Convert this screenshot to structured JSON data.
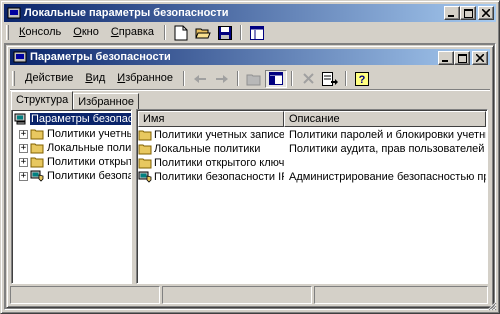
{
  "app": {
    "title": "Локальные параметры безопасности",
    "menu": [
      "Консоль",
      "Окно",
      "Справка"
    ],
    "menu_underline": [
      "К",
      "О",
      "С"
    ]
  },
  "child": {
    "title": "Параметры безопасности",
    "menu": [
      "Действие",
      "Вид",
      "Избранное"
    ],
    "menu_underline": [
      "Д",
      "В",
      "И"
    ]
  },
  "tabs": {
    "structure": "Структура",
    "favorites": "Избранное"
  },
  "tree": {
    "root": "Параметры безопасности",
    "items": [
      "Политики учетных записей",
      "Локальные политики",
      "Политики открытого ключа",
      "Политики безопасности IP на"
    ]
  },
  "list": {
    "columns": [
      "Имя",
      "Описание"
    ],
    "rows": [
      {
        "name": "Политики учетных записей",
        "desc": "Политики паролей и блокировки учетных записей"
      },
      {
        "name": "Локальные политики",
        "desc": "Политики аудита, прав пользователей и парам..."
      },
      {
        "name": "Политики открытого ключа",
        "desc": ""
      },
      {
        "name": "Политики безопасности IP н...",
        "desc": "Администрирование безопасностью протокола ..."
      }
    ]
  },
  "colors": {
    "title_active": "#0a246a",
    "title_gradient_end": "#a6caf0",
    "face": "#d4d0c8"
  },
  "icons": [
    "app-icon",
    "new-icon",
    "open-icon",
    "save-icon",
    "window-icon",
    "back-icon",
    "forward-icon",
    "up-icon",
    "show-tree-icon",
    "delete-icon",
    "export-icon",
    "help-icon",
    "folder-icon",
    "shield-icon",
    "computer-icon"
  ]
}
